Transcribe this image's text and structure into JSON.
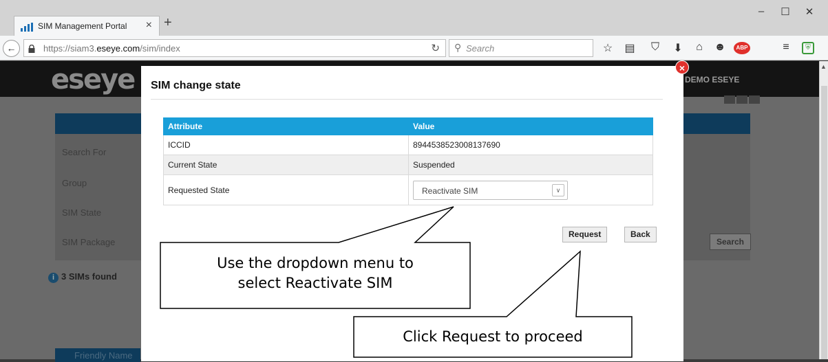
{
  "browser": {
    "tab_title": "SIM Management Portal",
    "tab_close": "×",
    "new_tab": "+",
    "url_prefix": "https://siam3.",
    "url_domain": "eseye.com",
    "url_suffix": "/sim/index",
    "search_placeholder": "Search",
    "window_minimize": "–",
    "window_maximize": "☐",
    "window_close": "✕",
    "adblock_badge": "ABP"
  },
  "page": {
    "logo": "eseye",
    "user_menu": "DEMO ESEYE",
    "labels": [
      "Search For",
      "Group",
      "SIM State",
      "SIM Package"
    ],
    "search_button": "Search",
    "found_text": "3 SIMs found",
    "table_header_partial": "Friendly Name"
  },
  "modal": {
    "title": "SIM change state",
    "close": "×",
    "table": {
      "headers": [
        "Attribute",
        "Value"
      ],
      "rows": [
        {
          "attribute": "ICCID",
          "value": "8944538523008137690"
        },
        {
          "attribute": "Current State",
          "value": "Suspended"
        },
        {
          "attribute": "Requested State",
          "value": "Reactivate SIM"
        }
      ]
    },
    "request_button": "Request",
    "back_button": "Back"
  },
  "callouts": {
    "dropdown_line1": "Use the dropdown menu to",
    "dropdown_line2": "select Reactivate SIM",
    "request": "Click Request to proceed"
  },
  "colors": {
    "table_header": "#199fd9",
    "close_badge": "#e0302c",
    "page_header": "#141414",
    "page_bluebar": "#0e3b5b"
  }
}
